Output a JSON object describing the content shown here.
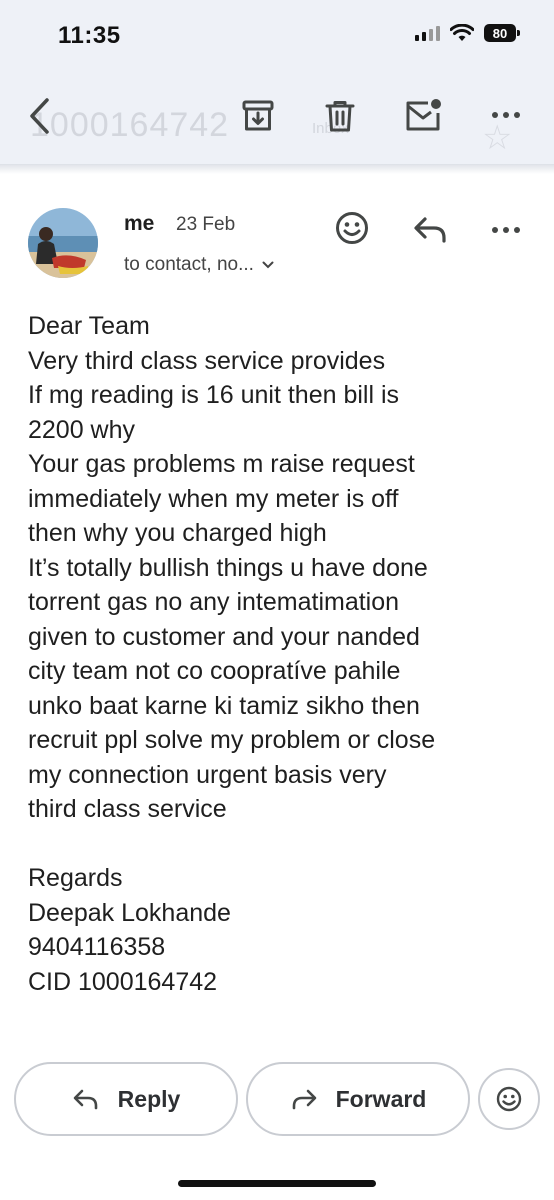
{
  "status_bar": {
    "time": "11:35",
    "battery": "80"
  },
  "toolbar": {
    "subject_ghost": "1000164742",
    "label_ghost": "Inbox",
    "icons": [
      "back-icon",
      "archive-icon",
      "trash-icon",
      "mark-unread-icon",
      "more-icon",
      "star-icon"
    ]
  },
  "message": {
    "sender": "me",
    "date": "23 Feb",
    "recipients": "to contact, no...",
    "body_lines": [
      "Dear Team",
      "Very third class service provides",
      "If mg reading is 16 unit then bill is",
      "2200 why",
      "Your gas problems m raise request",
      "immediately when my meter is off",
      "then why you charged high",
      "It’s totally bullish things u have done",
      "torrent gas no any intematimation",
      "given to customer and your nanded",
      "city team not co coopratíve pahile",
      "unko baat karne ki tamiz sikho then",
      "recruit ppl solve my problem or close",
      "my connection urgent basis very",
      "third class service",
      "",
      "Regards",
      "Deepak Lokhande",
      "9404116358",
      "CID 1000164742"
    ]
  },
  "actions": {
    "reply_label": "Reply",
    "forward_label": "Forward"
  },
  "colors": {
    "toolbar_bg": "#eef1f7",
    "icon": "#444746",
    "text": "#1f1f1f"
  }
}
